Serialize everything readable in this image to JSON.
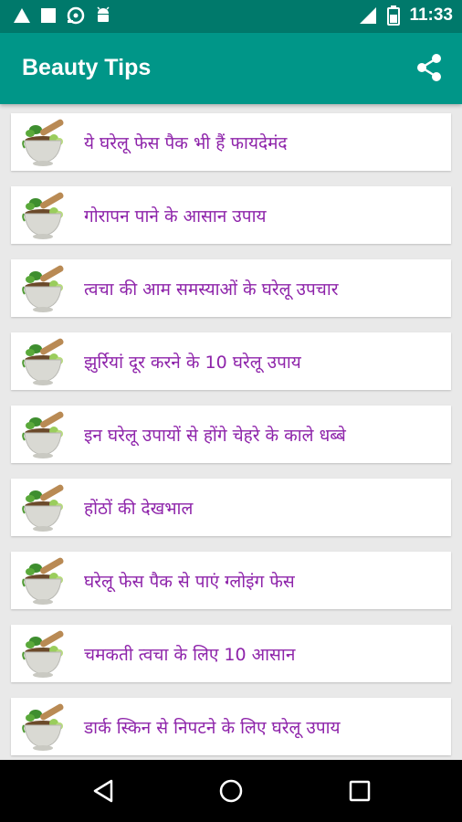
{
  "status_bar": {
    "time": "11:33"
  },
  "app_bar": {
    "title": "Beauty Tips",
    "icon": "share-icon"
  },
  "colors": {
    "primary": "#009688",
    "primary_dark": "#00796b",
    "item_text": "#8e24aa",
    "background": "#e9e9e9"
  },
  "items": [
    {
      "label": "ये घरेलू फेस पैक भी हैं फायदेमंद"
    },
    {
      "label": "गोरापन पाने के  आसान उपाय"
    },
    {
      "label": "त्वचा की आम समस्याओं के  घरेलू उपचार"
    },
    {
      "label": "झुर्रियां दूर करने के 10 घरेलू उपाय"
    },
    {
      "label": "इन घरेलू उपायों से होंगे चेहरे के  काले धब्बे"
    },
    {
      "label": "होंठों की देखभाल"
    },
    {
      "label": "घरेलू फेस पैक से पाएं ग्लोइंग फेस"
    },
    {
      "label": "चमकती त्वचा के  लिए 10 आसान"
    },
    {
      "label": "डार्क स्किन से निपटने के  लिए घरेलू उपाय"
    }
  ],
  "nav_bar": {
    "back": "back-icon",
    "home": "home-icon",
    "recents": "recents-icon"
  }
}
